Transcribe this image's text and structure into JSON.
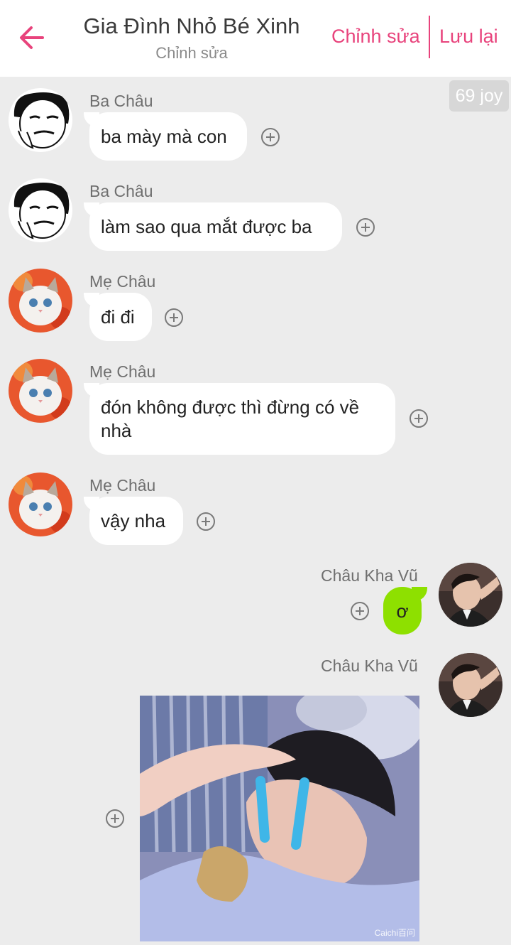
{
  "header": {
    "title": "Gia Đình Nhỏ Bé Xinh",
    "subtitle": "Chỉnh sửa",
    "edit_label": "Chỉnh sửa",
    "save_label": "Lưu lại",
    "accent_color": "#e8437c"
  },
  "counter": "69 joy",
  "messages": [
    {
      "sender": "Ba Châu",
      "text": "ba mày mà con",
      "side": "left",
      "avatar": "meme-face"
    },
    {
      "sender": "Ba Châu",
      "text": "làm sao qua mắt được ba",
      "side": "left",
      "avatar": "meme-face"
    },
    {
      "sender": "Mẹ Châu",
      "text": "đi đi",
      "side": "left",
      "avatar": "cat"
    },
    {
      "sender": "Mẹ Châu",
      "text": "đón không được thì đừng có về nhà",
      "side": "left",
      "avatar": "cat"
    },
    {
      "sender": "Mẹ Châu",
      "text": "vậy nha",
      "side": "left",
      "avatar": "cat"
    },
    {
      "sender": "Châu Kha Vũ",
      "text": "ơ",
      "side": "right",
      "avatar": "boy-photo",
      "bubble_color": "#8ee000"
    },
    {
      "sender": "Châu Kha Vũ",
      "text": "",
      "side": "right",
      "avatar": "boy-photo",
      "type": "image",
      "watermark": "Caichi百问"
    }
  ],
  "icons": {
    "back": "arrow-left-icon",
    "add": "plus-circle-icon"
  }
}
